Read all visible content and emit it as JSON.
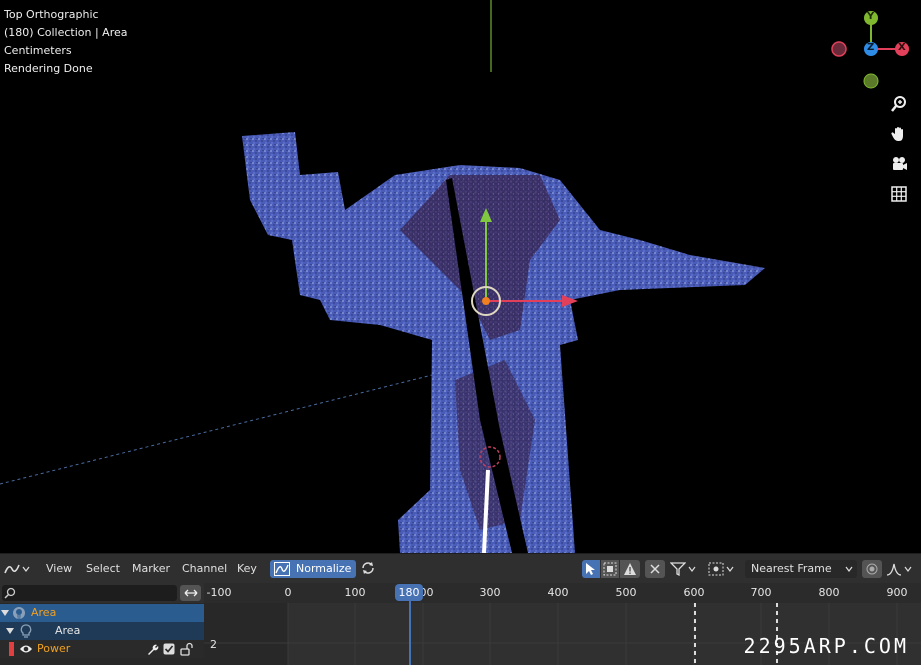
{
  "viewport": {
    "overlay_lines": [
      "Top Orthographic",
      "(180) Collection | Area",
      "Centimeters",
      "Rendering Done"
    ],
    "gizmo": {
      "y_label": "Y",
      "z_label": "Z",
      "x_label": "X",
      "colors": {
        "x": "#e2405a",
        "y": "#7fb82f",
        "z": "#2f8ce6"
      }
    },
    "nav_icons": [
      "zoom-icon",
      "pan-hand-icon",
      "camera-icon",
      "grid-icon"
    ]
  },
  "graph_editor": {
    "menus": {
      "view": "View",
      "select": "Select",
      "marker": "Marker",
      "channel": "Channel",
      "key": "Key"
    },
    "normalize_label": "Normalize",
    "snap_mode": "Nearest Frame",
    "accent": "#4772b3"
  },
  "channels": {
    "search_placeholder": "",
    "rows": {
      "object": "Area",
      "data": "Area",
      "channel": "Power"
    }
  },
  "timeline": {
    "tick_labels": [
      "-100",
      "0",
      "100",
      "200",
      "300",
      "400",
      "500",
      "600",
      "700",
      "800",
      "900"
    ],
    "current_frame": "180",
    "y_value_label": "2"
  },
  "watermark": "2295ARP.COM"
}
